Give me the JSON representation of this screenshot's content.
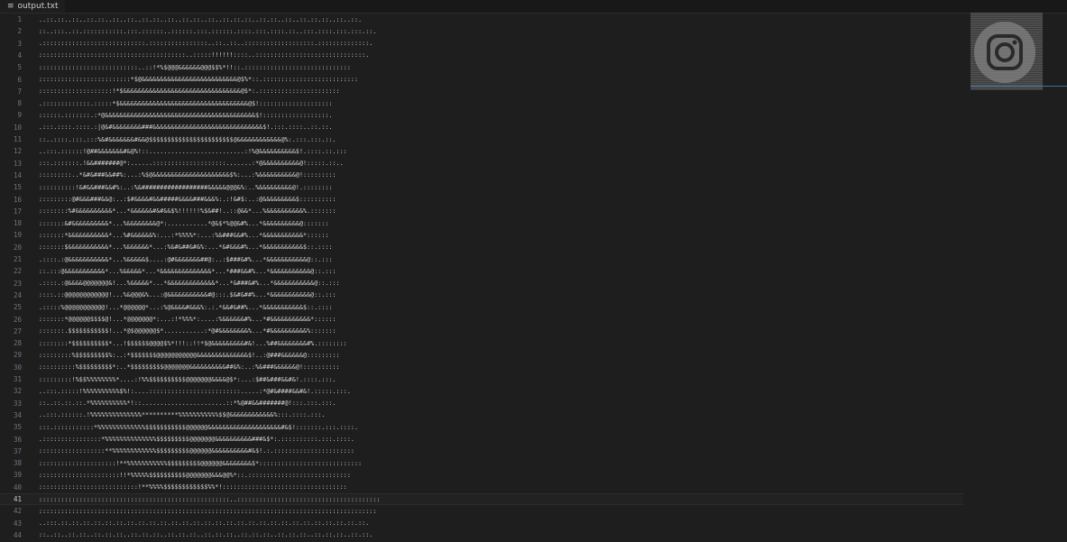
{
  "tab": {
    "label": "output.txt",
    "icon": "text-file-icon"
  },
  "editor": {
    "current_line": 41,
    "lines": [
      "..::.::..::..::.::..::..::..::.::..::..::.::..::..::.::.::..::.::..::..::.::.::..::..::.",
      "::..:::..::.:::::::::::.:::.::::::..::::::.:::.::::::.::::.:::.::::.::..:::.::::.:::.:::.::.",
      ".::::::::::::::::::::::::::::.::::::::::::::::..::..::..:::::::::::::::::::.::::::::::::::.",
      "::::::::::::::::::::::::::::::::::::::::..:::::!!!!!!::::..::::::::::::::::::::::::::::::.",
      ":::::::::::::::::::::::::::..::!*%$@@@&&&&&&@@@$$%*!!::.:::::::::::::::::::::::::::::",
      ":::::::::::::::::::::::::*$@&&&&&&&&&&&&&&&&&&&&&&&&&&@$%*::.::::::::::::::::::::::::::",
      "::::::::::::::::::::!*$&&&&&&&&&&&&&&&&&&&&&&&&&&&&&&&&@$*:.::::::::::::::::::::::",
      ".:::::::::::::.:::::*$&&&&&&&&&&&&&&&&&&&&&&&&&&&&&&&&&&&@$!::::::::::::::::::::",
      "::::::.:::::::.:*@&&&&&&&&&&&&&&&&&&&&&&&&&&&&&&&&&&&&&&&&&$!::::::::::::::::::.",
      ".:::.::::.::::.:|@&#&&&&&&&&###&&&&&&&&&&&&&&&&&&&&&&&&&&&&&&$!.:::.::::..::.::.",
      "::..::::.:::.:::%&#&&&&&&&#&&@$$$$$$$$$$$$$$$$$$$$$$$@&&&&&&&&&&&&@%:.:::.:::.::.",
      "..:::.::::::!@##&&&&&&&#&@%!::..........................:!%@&&&&&&&&&&$!.::::.::.:::",
      ":::.:::::::.!&&#######@*:......::::::::::::::::::::.......:*@&&&&&&&&&&@!:::::.::..",
      ":::::::::..*&#&###&&##%:...:%$@&&&&&&&&&&&&&&&&&&&&&$%:...:%&&&&&&&&&&@!:::::::::",
      "::::::::::!&#&&###&&#%:..:%&##################&&&&&@@@&%:..%&&&&&&&&&@!.::::::::",
      ":::::::::@#&&&###&&@:..:$#&&&&#&&#####&&&&###&&&%:.:!&#$:..:@&&&&&&&&&$::::::::::",
      "::::::::%#&&&&&&&&&&*...*&&&&&&#&#&&$%!!!!!!%$&##!..::@&&*...%&&&&&&&&&&%.:::::::",
      ":::::::&#&&&&&&&&&&*...%&&&&&&&&@*:...........*@&$*%@@&#%...*&&&&&&&&&&@:::::::",
      ":::::::*&&&&&&&&&&&*...%#&&&&&&%:...:*%%%%*:...:%&###&&#%...*&&&&&&&&&&&*::::::",
      ":::::::$&&&&&&&&&&&*...%&&&&&&*...:%&#&##&#&%:...*&#&&&#%...*&&&&&&&&&&&$::.::::",
      ".::::.:@&&&&&&&&&&&*...%&&&&&$....:@#&&&&&&&##@:..:$###&#%...*&&&&&&&&&&&@::.:::",
      "::.:::@&&&&&&&&&&&*...%&&&&&*...*&&&&&&&&&&&&&&*...*###&&#%...*&&&&&&&&&&&@::.:::",
      ".::::.:@&&&&@@@@@@@&!...%&&&&&*...*&&&&&&&&&&&&&*...*&###&#%...*&&&&&&&&&&&@::.:::",
      "::::.::@@@@@@@@@@@@!...%&@@@&%...:@&&&&&&&&&&&#@:::.$&#&##%...*&&&&&&&&&&&@::.:::",
      ".:::::%@@@@@@@@@@@!...*@@@@@@*...:%@&&&&#&&&%:.:.*&&#&##%...*&&&&&&&&&&&$::.::::",
      ":::::::*@@@@@@$$$$@!...*@@@@@@@*:...:!*%%%*:....:%&&&&&&#%...*#&&&&&&&&&&&*::::::",
      ":::::::.$$$$$$$$$$$!...*@$@@@@@@$*...........:*@#&&&&&&&&%...*#&&&&&&&&&&%:::::::",
      "::::::::*$$$$$$$$$$*...!$$$$$$@@@@$%*!!!::!!*$@&&&&&&&&&#&!...%##&&&&&&&&#%.::::::::",
      ":::::::::%$$$$$$$$$%:..:*$$$$$$$@@@@@@@@@@@&&&&&&&&&&&&&&$!..:@###&&&&&&@:::::::::",
      "::::::::::%$$$$$$$$$*:..*$$$$$$$$$@@@@@@@&&&&&&&&&&##&%:..:%&###&&&&&&@!::::::::::",
      ":::::::::!%$$%%%%%%%%*....:!%%$$$$$$$$$$@@@@@@@&&&&@$*:...:$##&###&&#&!.::::.:::.",
      "..:::.:::::!%%%%%%%%%%$%!:....:::::::::::::::::::::::::.....:*@#&####&&#&!.:::::.:::.",
      "::..::.::.::.*%%%%%%%%%%*!::.......................::*%@##&&#######@!:::.:::.:::.",
      "..:::.::::::.!%%%%%%%%%%%%%%**********%%%%%%%%%%%$$@&&&&&&&&&&&&%:::.::::.:::.",
      ":::.:::::::::::*%%%%%%%%%%%%%$$$$$$$$$$$@@@@@@&&&&&&&&&&&&&&&&&&&&#&$!:::::::.:::.::::.",
      ".::::::::::::::::*%%%%%%%%%%%%%%$$$$$$$$$@@@@@@@&&&&&&&&&&###&$*:.::::::::::.:::.::::.",
      "::::::::::::::::::**%%%%%%%%%%%%$$$$$$$$$@@@@@@&&&&&&&&&&#&$!.:.::::::::::::::::::::::",
      ":::::::::::::::::::::!**%%%%%%%%%%%$$$$$$$$$@@@@@@&&&&&&&&$*::::::::::::::::::::::::::::",
      "::::::::::::::::::::::!!*%%%%%$$$$$$$$$$@@@@@@@&&&@@%*::.::::::::::::::::::::::::::::",
      ":::::::::::::::::::::::::::!**%%%%$$$$$$$$$$$$%%*!::::::::::::::::::::::::::::::::::",
      "::::::::::::::::::::::::::::::::::::::::::::::::::::..:::::::::::::::::::::::::::::::::::::::",
      "::::::::::::::::::::::::::::::::::::::::::::::::::::::::::::::::::::::::::::::::::::::::::::",
      "..:::.::.::.::.::.::.::.::.::.::.::.::.::.::.::.::.::.::.::.::.::.::.::.::.::.::.::.::.::.",
      "::..::..::.::..::.::.::..::.::.::..::.::.::..::.::.::..::.::.::..::.::.::..::.::.::..::.::."
    ]
  },
  "minimap": {
    "icon": "instagram-logo-icon"
  },
  "colors": {
    "background": "#1e1e1e",
    "text": "#d4d4d4",
    "line_number": "#6e7681",
    "accent": "#3c6ea3"
  }
}
